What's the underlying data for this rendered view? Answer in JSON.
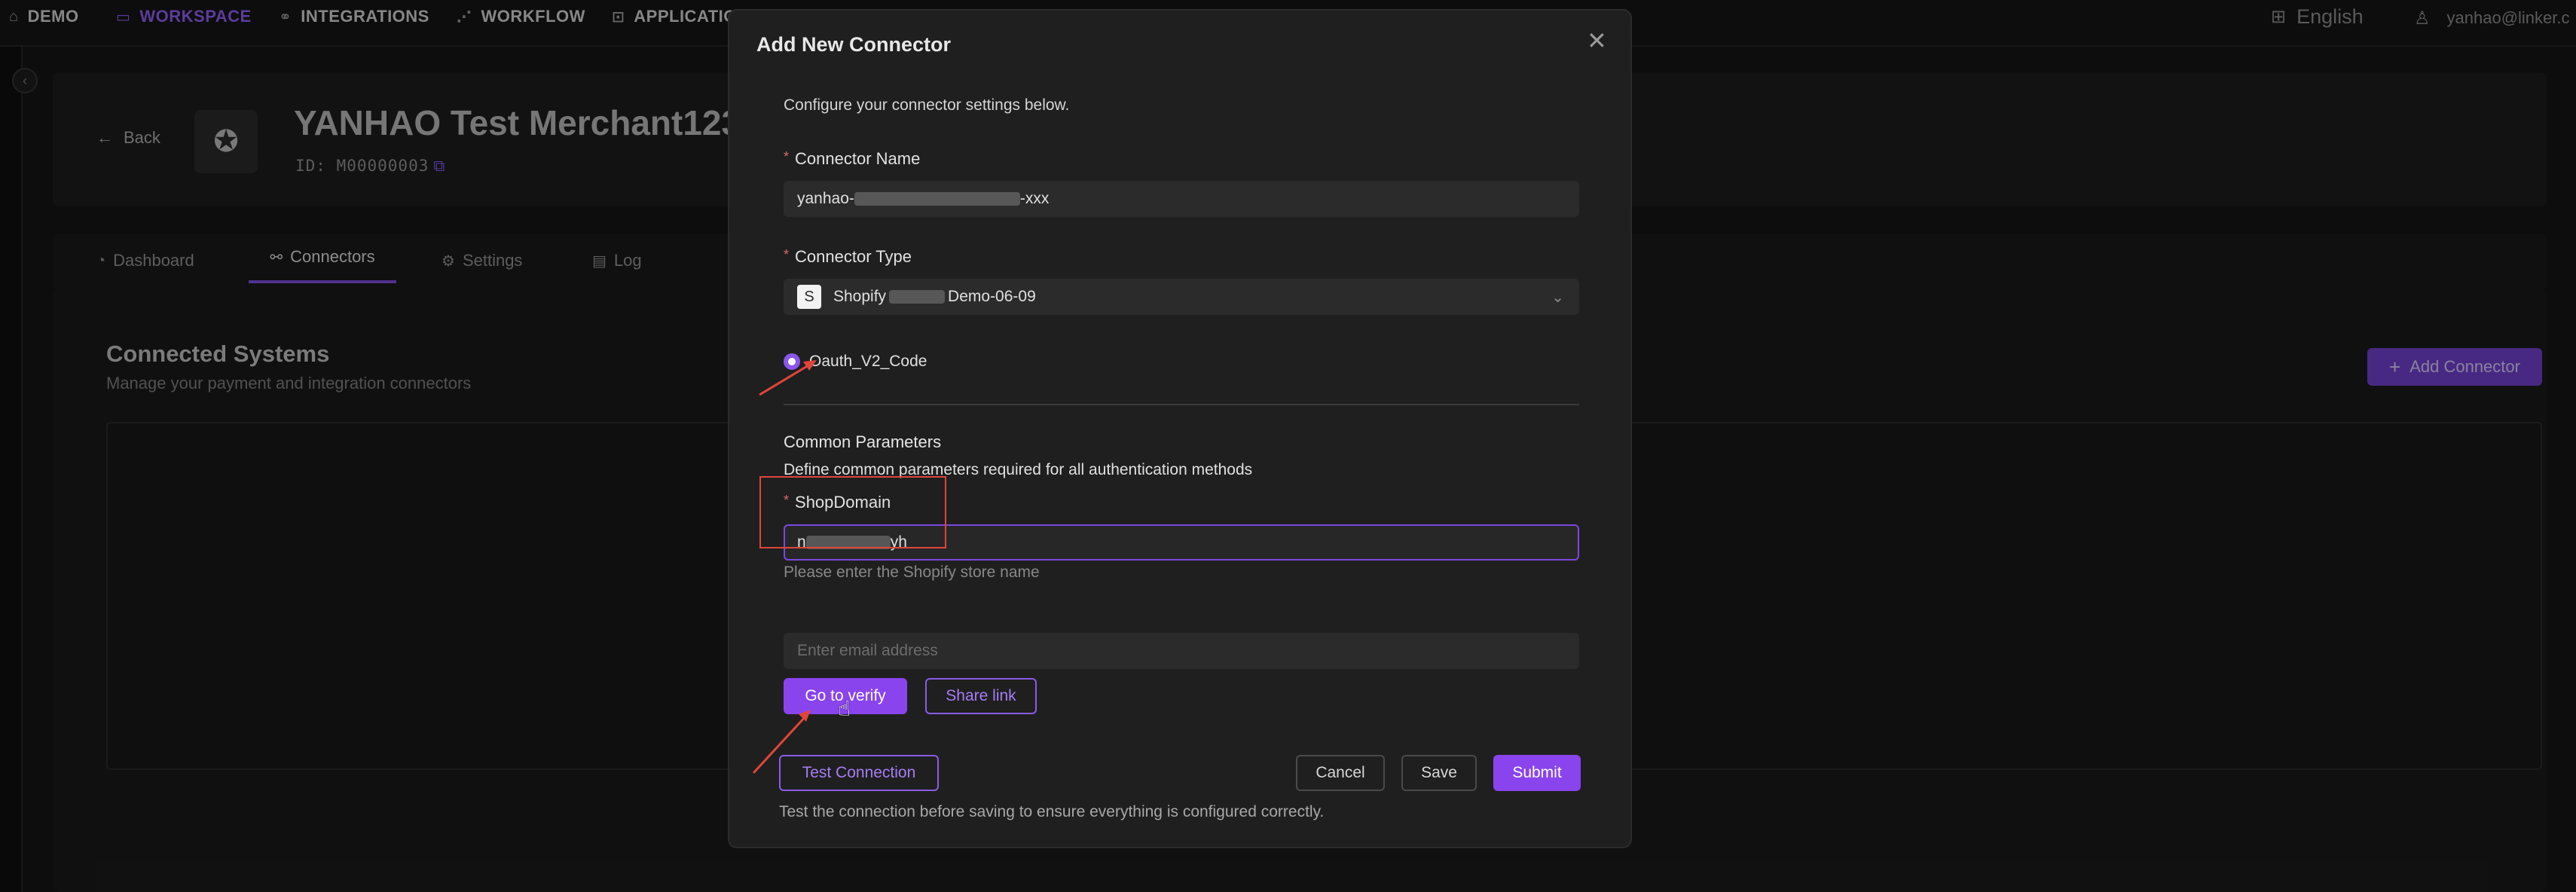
{
  "nav": {
    "items": [
      {
        "label": "DEMO",
        "icon": "home-icon",
        "active": false
      },
      {
        "label": "WORKSPACE",
        "icon": "monitor-icon",
        "active": true
      },
      {
        "label": "INTEGRATIONS",
        "icon": "link-icon",
        "active": false
      },
      {
        "label": "WORKFLOW",
        "icon": "share-nodes-icon",
        "active": false
      },
      {
        "label": "APPLICATIO",
        "icon": "api-icon",
        "active": false
      }
    ],
    "language": "English",
    "user": "yanhao@linker.c"
  },
  "merchant": {
    "back_label": "Back",
    "title": "YANHAO Test Merchant123",
    "id_label": "ID: M00000003"
  },
  "tabs": [
    {
      "label": "Dashboard",
      "icon": "dashboard-icon",
      "active": false
    },
    {
      "label": "Connectors",
      "icon": "link-icon",
      "active": true
    },
    {
      "label": "Settings",
      "icon": "gear-icon",
      "active": false
    },
    {
      "label": "Log",
      "icon": "document-icon",
      "active": false
    }
  ],
  "section": {
    "title": "Connected Systems",
    "subtitle": "Manage your payment and integration connectors",
    "add_button": "Add Connector"
  },
  "modal": {
    "title": "Add New Connector",
    "description": "Configure your connector settings below.",
    "connector_name": {
      "label": "Connector Name",
      "value_prefix": "yanhao-",
      "value_suffix": "-xxx"
    },
    "connector_type": {
      "label": "Connector Type",
      "value_prefix": "Shopify",
      "value_suffix": "Demo-06-09"
    },
    "auth_option": "Oauth_V2_Code",
    "common": {
      "title": "Common Parameters",
      "description": "Define common parameters required for all authentication methods"
    },
    "shop_domain": {
      "label": "ShopDomain",
      "value_prefix": "n",
      "value_suffix": "yh",
      "hint": "Please enter the Shopify store name"
    },
    "email": {
      "placeholder": "Enter email address"
    },
    "buttons": {
      "verify": "Go to verify",
      "share": "Share link",
      "test": "Test Connection",
      "cancel": "Cancel",
      "save": "Save",
      "submit": "Submit"
    },
    "footer_note": "Test the connection before saving to ensure everything is configured correctly."
  },
  "colors": {
    "accent": "#8a44ee",
    "annotation": "#e0453a"
  }
}
